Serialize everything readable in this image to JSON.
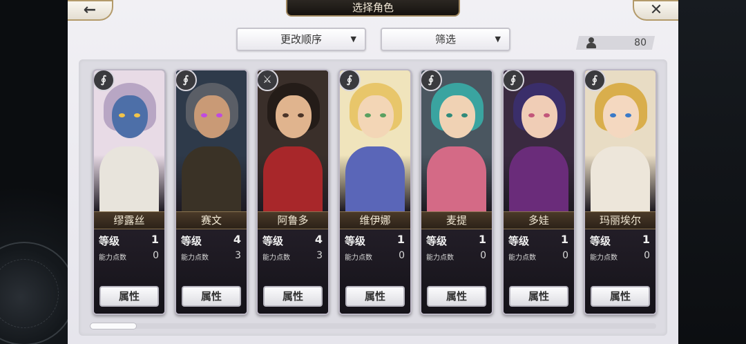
{
  "header": {
    "title": "选择角色",
    "back_icon": "back-arrow",
    "close_icon": "close-x",
    "back_glyph": "←",
    "close_glyph": "✕"
  },
  "toolbar": {
    "sort_label": "更改顺序",
    "filter_label": "筛选",
    "caret": "▼",
    "character_count": "80"
  },
  "stat_labels": {
    "level": "等级",
    "ability_points": "能力点数",
    "attributes_button": "属性"
  },
  "characters": [
    {
      "name": "缪露丝",
      "level": "1",
      "ability_points": "0",
      "weapon": "staff-icon",
      "weapon_glyph": "∮",
      "colors": {
        "bg": "#e8dbe6",
        "hair": "#b8a6c4",
        "skin": "#4d6fa8",
        "body": "#e8e4dc",
        "eye": "#f2c44a"
      }
    },
    {
      "name": "赛文",
      "level": "4",
      "ability_points": "3",
      "weapon": "staff-icon",
      "weapon_glyph": "∮",
      "colors": {
        "bg": "#2e3a4a",
        "hair": "#5a5e66",
        "skin": "#c99a76",
        "body": "#3a3226",
        "eye": "#c04ae0"
      }
    },
    {
      "name": "阿鲁多",
      "level": "4",
      "ability_points": "3",
      "weapon": "sword-icon",
      "weapon_glyph": "⚔",
      "colors": {
        "bg": "#3a2f2a",
        "hair": "#241c18",
        "skin": "#e0b48e",
        "body": "#a8272a",
        "eye": "#4a3428"
      }
    },
    {
      "name": "维伊娜",
      "level": "1",
      "ability_points": "0",
      "weapon": "staff-icon",
      "weapon_glyph": "∮",
      "colors": {
        "bg": "#f0e4bc",
        "hair": "#e8c66a",
        "skin": "#f3d6b6",
        "body": "#5a66b8",
        "eye": "#5aa060"
      }
    },
    {
      "name": "麦提",
      "level": "1",
      "ability_points": "0",
      "weapon": "staff-icon",
      "weapon_glyph": "∮",
      "colors": {
        "bg": "#4a5660",
        "hair": "#3aa4a0",
        "skin": "#f0d2b4",
        "body": "#d46a86",
        "eye": "#2f8a7a"
      }
    },
    {
      "name": "多娃",
      "level": "1",
      "ability_points": "0",
      "weapon": "staff-icon",
      "weapon_glyph": "∮",
      "colors": {
        "bg": "#3a2a40",
        "hair": "#3a2e6a",
        "skin": "#f0cdb6",
        "body": "#6a2c7a",
        "eye": "#c2567a"
      }
    },
    {
      "name": "玛丽埃尔",
      "level": "1",
      "ability_points": "0",
      "weapon": "staff-icon",
      "weapon_glyph": "∮",
      "colors": {
        "bg": "#e8dcc4",
        "hair": "#d9ae4c",
        "skin": "#f4d8c0",
        "body": "#ede6da",
        "eye": "#3a7ac8"
      }
    }
  ],
  "scroll": {
    "position": 0.0
  }
}
